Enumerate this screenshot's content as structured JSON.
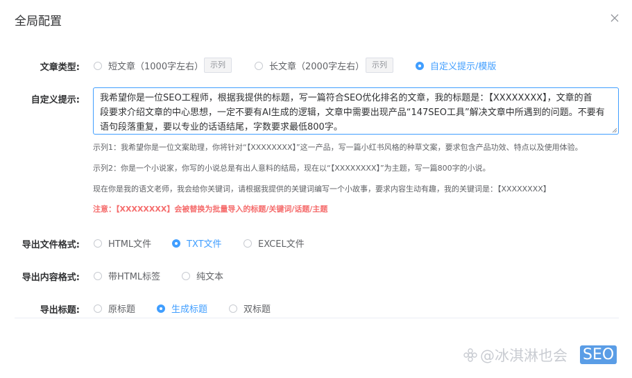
{
  "dialog": {
    "title": "全局配置",
    "close_icon": "close-icon"
  },
  "article_type": {
    "label": "文章类型:",
    "options": [
      {
        "label": "短文章（1000字左右）",
        "checked": false,
        "example_label": "示列"
      },
      {
        "label": "长文章（2000字左右）",
        "checked": false,
        "example_label": "示列"
      },
      {
        "label": "自定义提示/模版",
        "checked": true
      }
    ]
  },
  "custom_prompt": {
    "label": "自定义提示:",
    "value_lines": [
      "我希望你是一位SEO工程师，根据我提供的标题，写一篇符合SEO优化排名的文章，我的标题是：【XXXXXXXX】，文章的首",
      "段要求介绍文章的中心思想，一定不要有AI生成的逻辑，文章中需要出现产品“147SEO工具”解决文章中所遇到的问题。不要有",
      "语句段落重复，要以专业的话语结尾，字数要求最低800字。"
    ],
    "examples": [
      "示列1：我希望你是一位文案助理，你将针对“【XXXXXXXX】”这一产品，写一篇小红书风格的种草文案，要求包含产品功效、特点以及使用体验。",
      "示列2：你是一个小说家，你写的小说总是有出人意料的结局，现在以“【XXXXXXXX】”为主题，写一篇800字的小说。",
      "现在你是我的语文老师，我会给你关键词，请根据我提供的关键词编写一个小故事，要求内容生动有趣，我的关键词是：【XXXXXXXX】"
    ],
    "notice": "注意：【XXXXXXXX】会被替换为批量导入的标题/关键词/话题/主题"
  },
  "export_file_format": {
    "label": "导出文件格式:",
    "options": [
      {
        "label": "HTML文件",
        "checked": false
      },
      {
        "label": "TXT文件",
        "checked": true
      },
      {
        "label": "EXCEL文件",
        "checked": false
      }
    ]
  },
  "export_content_format": {
    "label": "导出内容格式:",
    "options": [
      {
        "label": "带HTML标签",
        "checked": false
      },
      {
        "label": "纯文本",
        "checked": false
      }
    ]
  },
  "export_title": {
    "label": "导出标题:",
    "options": [
      {
        "label": "原标题",
        "checked": false
      },
      {
        "label": "生成标题",
        "checked": true
      },
      {
        "label": "双标题",
        "checked": false
      }
    ]
  },
  "watermark": {
    "text": "@冰淇淋也会",
    "badge": "SEO"
  },
  "colors": {
    "primary": "#409eff",
    "danger": "#f56c6c"
  }
}
